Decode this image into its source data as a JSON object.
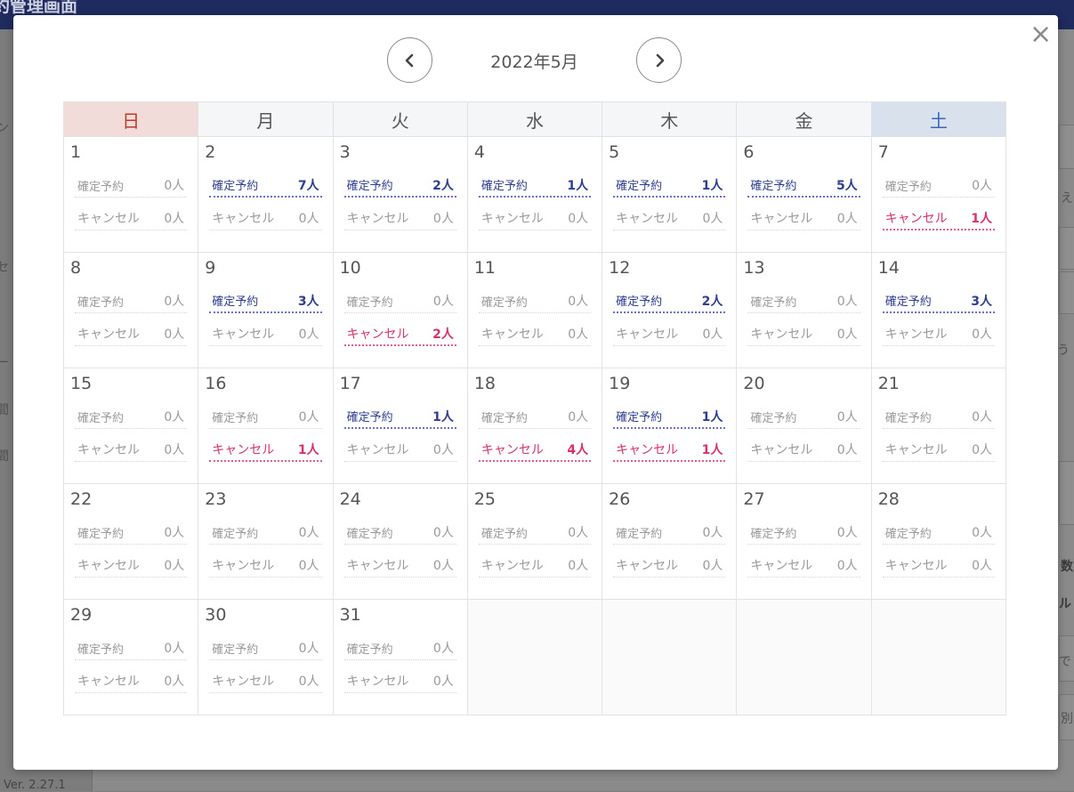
{
  "background": {
    "title": "約管理画面",
    "version": "Ver. 2.27.1",
    "sidebar_fragments": [
      "ン",
      "セ",
      "ー",
      "間",
      "間"
    ],
    "right_fragments": [
      "え",
      "う",
      "数",
      "ル",
      "で",
      "別"
    ]
  },
  "modal": {
    "close_label": "×",
    "month_title": "2022年5月",
    "prev_icon": "chevron-left-icon",
    "next_icon": "chevron-right-icon",
    "weekdays": [
      "日",
      "月",
      "火",
      "水",
      "木",
      "金",
      "土"
    ],
    "confirmed_label": "確定予約",
    "cancel_label": "キャンセル",
    "colors": {
      "confirmed": "#2f3e8f",
      "cancel": "#d6336c",
      "sunday": "#c0392b",
      "saturday": "#3a65b8"
    },
    "weeks": [
      [
        {
          "day": "1",
          "confirmed": "0人",
          "cancel": "0人"
        },
        {
          "day": "2",
          "confirmed": "7人",
          "cancel": "0人"
        },
        {
          "day": "3",
          "confirmed": "2人",
          "cancel": "0人"
        },
        {
          "day": "4",
          "confirmed": "1人",
          "cancel": "0人"
        },
        {
          "day": "5",
          "confirmed": "1人",
          "cancel": "0人"
        },
        {
          "day": "6",
          "confirmed": "5人",
          "cancel": "0人"
        },
        {
          "day": "7",
          "confirmed": "0人",
          "cancel": "1人"
        }
      ],
      [
        {
          "day": "8",
          "confirmed": "0人",
          "cancel": "0人"
        },
        {
          "day": "9",
          "confirmed": "3人",
          "cancel": "0人"
        },
        {
          "day": "10",
          "confirmed": "0人",
          "cancel": "2人"
        },
        {
          "day": "11",
          "confirmed": "0人",
          "cancel": "0人"
        },
        {
          "day": "12",
          "confirmed": "2人",
          "cancel": "0人"
        },
        {
          "day": "13",
          "confirmed": "0人",
          "cancel": "0人"
        },
        {
          "day": "14",
          "confirmed": "3人",
          "cancel": "0人"
        }
      ],
      [
        {
          "day": "15",
          "confirmed": "0人",
          "cancel": "0人"
        },
        {
          "day": "16",
          "confirmed": "0人",
          "cancel": "1人"
        },
        {
          "day": "17",
          "confirmed": "1人",
          "cancel": "0人"
        },
        {
          "day": "18",
          "confirmed": "0人",
          "cancel": "4人"
        },
        {
          "day": "19",
          "confirmed": "1人",
          "cancel": "1人"
        },
        {
          "day": "20",
          "confirmed": "0人",
          "cancel": "0人"
        },
        {
          "day": "21",
          "confirmed": "0人",
          "cancel": "0人"
        }
      ],
      [
        {
          "day": "22",
          "confirmed": "0人",
          "cancel": "0人"
        },
        {
          "day": "23",
          "confirmed": "0人",
          "cancel": "0人"
        },
        {
          "day": "24",
          "confirmed": "0人",
          "cancel": "0人"
        },
        {
          "day": "25",
          "confirmed": "0人",
          "cancel": "0人"
        },
        {
          "day": "26",
          "confirmed": "0人",
          "cancel": "0人"
        },
        {
          "day": "27",
          "confirmed": "0人",
          "cancel": "0人"
        },
        {
          "day": "28",
          "confirmed": "0人",
          "cancel": "0人"
        }
      ],
      [
        {
          "day": "29",
          "confirmed": "0人",
          "cancel": "0人"
        },
        {
          "day": "30",
          "confirmed": "0人",
          "cancel": "0人"
        },
        {
          "day": "31",
          "confirmed": "0人",
          "cancel": "0人"
        },
        null,
        null,
        null,
        null
      ]
    ]
  }
}
